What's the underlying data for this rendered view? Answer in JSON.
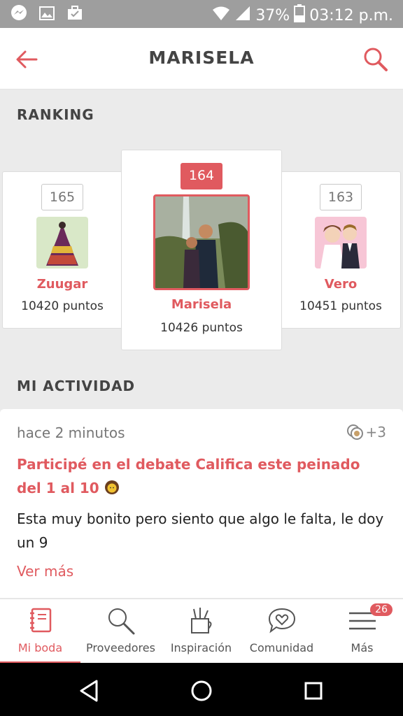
{
  "status_bar": {
    "battery": "37%",
    "time": "03:12 p.m.",
    "icons": [
      "messenger-icon",
      "image-icon",
      "briefcase-icon",
      "wifi-icon",
      "signal-icon",
      "battery-icon"
    ]
  },
  "app_bar": {
    "title": "MARISELA",
    "back_icon": "arrow-left-icon",
    "search_icon": "search-icon"
  },
  "ranking": {
    "header": "RANKING",
    "cards": [
      {
        "rank": "165",
        "name": "Zuugar",
        "points": "10420 puntos"
      },
      {
        "rank": "164",
        "name": "Marisela",
        "points": "10426 puntos"
      },
      {
        "rank": "163",
        "name": "Vero",
        "points": "10451 puntos"
      }
    ]
  },
  "activity": {
    "header": "MI ACTIVIDAD",
    "time": "hace 2 minutos",
    "count": "+3",
    "title": "Participé en el debate Califica este peinado del 1 al 10",
    "body": "Esta muy bonito pero siento que algo le falta, le doy un 9",
    "more": "Ver más"
  },
  "bottom_nav": {
    "items": [
      {
        "label": "Mi boda",
        "icon": "notebook-icon",
        "active": true
      },
      {
        "label": "Proveedores",
        "icon": "search-icon"
      },
      {
        "label": "Inspiración",
        "icon": "pencil-cup-icon"
      },
      {
        "label": "Comunidad",
        "icon": "chat-heart-icon"
      },
      {
        "label": "Más",
        "icon": "menu-icon",
        "badge": "26"
      }
    ]
  },
  "colors": {
    "accent": "#e05a5f",
    "background": "#ebebeb",
    "status_bar": "#9e9e9e"
  }
}
